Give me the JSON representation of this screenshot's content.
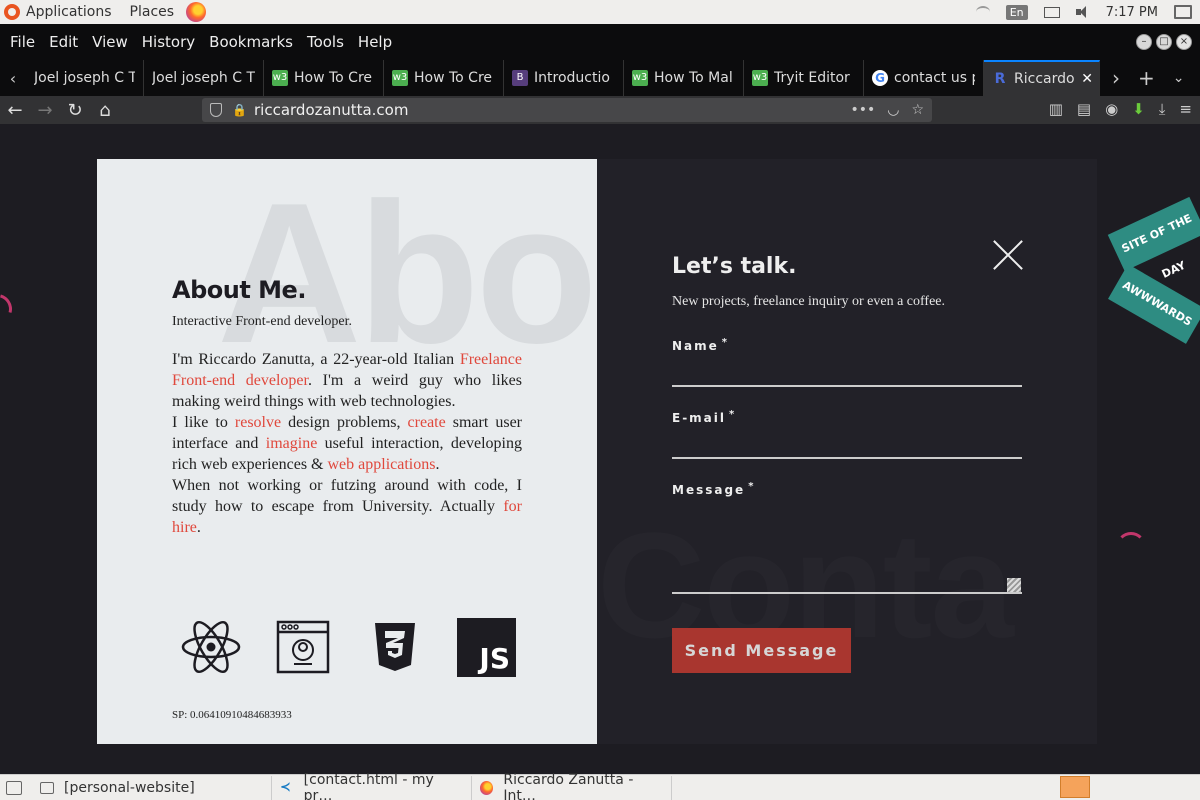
{
  "panel": {
    "applications": "Applications",
    "places": "Places",
    "lang": "En",
    "clock": "7:17 PM"
  },
  "menubar": {
    "items": [
      "File",
      "Edit",
      "View",
      "History",
      "Bookmarks",
      "Tools",
      "Help"
    ]
  },
  "tabs": [
    {
      "label": "Joel joseph C T",
      "favicon": "none"
    },
    {
      "label": "Joel joseph C T",
      "favicon": "none"
    },
    {
      "label": "How To Cre",
      "favicon": "w3"
    },
    {
      "label": "How To Cre",
      "favicon": "w3"
    },
    {
      "label": "Introductio",
      "favicon": "B"
    },
    {
      "label": "How To Mal",
      "favicon": "w3"
    },
    {
      "label": "Tryit Editor",
      "favicon": "w3"
    },
    {
      "label": "contact us p",
      "favicon": "G"
    },
    {
      "label": "Riccardo",
      "favicon": "R"
    }
  ],
  "navbar": {
    "url": "riccardozanutta.com"
  },
  "about": {
    "bg_word": "Abo",
    "title": "About Me.",
    "subtitle": "Interactive Front-end developer.",
    "p1_a": "I'm Riccardo Zanutta, a 22-year-old Italian ",
    "p1_link": "Freelance Front-end developer",
    "p1_b": ". I'm a weird guy who likes making weird things with web technologies.",
    "p2_a": "I like to ",
    "p2_link1": "resolve",
    "p2_b": " design problems, ",
    "p2_link2": "create",
    "p2_c": " smart user interface and ",
    "p2_link3": "imagine",
    "p2_d": " useful interaction, developing rich web experiences & ",
    "p2_link4": "web applications",
    "p2_e": ".",
    "p3_a": "When not working or futzing around with code, I study how to escape from University. Actually ",
    "p3_link": "for hire",
    "p3_b": ".",
    "js_label": "JS",
    "sp": "SP: 0.06410910484683933"
  },
  "contact": {
    "bg_word": "Conta",
    "title": "Let’s talk.",
    "subtitle": "New projects, freelance inquiry or even a coffee.",
    "name_label": "Name",
    "email_label": "E-mail",
    "message_label": "Message",
    "required_mark": "*",
    "send_label": "Send Message"
  },
  "awards": {
    "ribbon1": "SITE OF THE DAY",
    "ribbon2": "AWWWARDS"
  },
  "taskbar": {
    "items": [
      "[personal-website]",
      "[contact.html - my pr…",
      "Riccardo Zanutta - Int…"
    ]
  },
  "colors": {
    "accent": "#e0483c",
    "send_button": "#a9362f",
    "left_panel": "#e9ecee",
    "right_panel": "#222128",
    "page_bg": "#1d1c22"
  }
}
